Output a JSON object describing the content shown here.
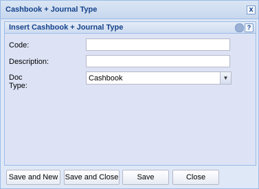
{
  "window": {
    "title": "Cashbook + Journal Type",
    "close_label": "x"
  },
  "panel": {
    "title": "Insert Cashbook + Journal Type",
    "help_label": "?"
  },
  "form": {
    "code_label": "Code:",
    "code_value": "",
    "description_label": "Description:",
    "description_value": "",
    "doctype_label": "Doc Type:",
    "doctype_value": "Cashbook"
  },
  "buttons": {
    "save_new": "Save and New",
    "save_close": "Save and Close",
    "save": "Save",
    "close": "Close"
  },
  "icons": {
    "close": "close-icon",
    "gear": "gear-icon",
    "help": "help-icon",
    "dropdown": "chevron-down-icon"
  }
}
